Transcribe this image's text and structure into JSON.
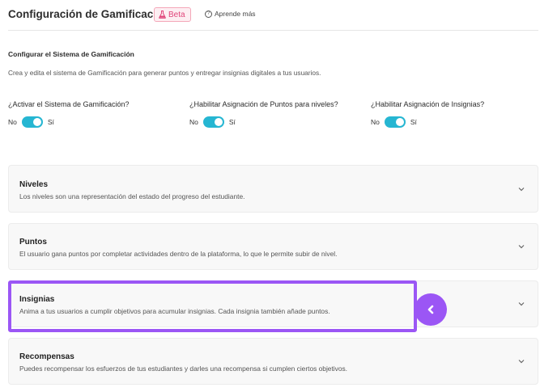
{
  "header": {
    "title": "Configuración de Gamificación",
    "beta_label": "Beta",
    "learn_more": "Aprende más"
  },
  "section": {
    "title": "Configurar el Sistema de Gamificación",
    "description": "Crea y edita el sistema de Gamificación para generar puntos y entregar insignias digitales a tus usuarios."
  },
  "toggles": [
    {
      "question": "¿Activar el Sistema de Gamificación?",
      "off_label": "No",
      "on_label": "Sí",
      "enabled": true
    },
    {
      "question": "¿Habilitar Asignación de Puntos para niveles?",
      "off_label": "No",
      "on_label": "Sí",
      "enabled": true
    },
    {
      "question": "¿Habilitar Asignación de Insignias?",
      "off_label": "No",
      "on_label": "Sí",
      "enabled": true
    }
  ],
  "cards": [
    {
      "title": "Niveles",
      "description": "Los niveles son una representación del estado del progreso del estudiante."
    },
    {
      "title": "Puntos",
      "description": "El usuario gana puntos por completar actividades dentro de la plataforma, lo que le permite subir de nivel."
    },
    {
      "title": "Insignias",
      "description": "Anima a tus usuarios a cumplir objetivos para acumular insignias. Cada insignia también añade puntos."
    },
    {
      "title": "Recompensas",
      "description": "Puedes recompensar los esfuerzos de tus estudiantes y darles una recompensa si cumplen ciertos objetivos."
    }
  ],
  "colors": {
    "toggle_on": "#26b6d2",
    "highlight": "#9b56f5",
    "beta_text": "#e0457a"
  }
}
